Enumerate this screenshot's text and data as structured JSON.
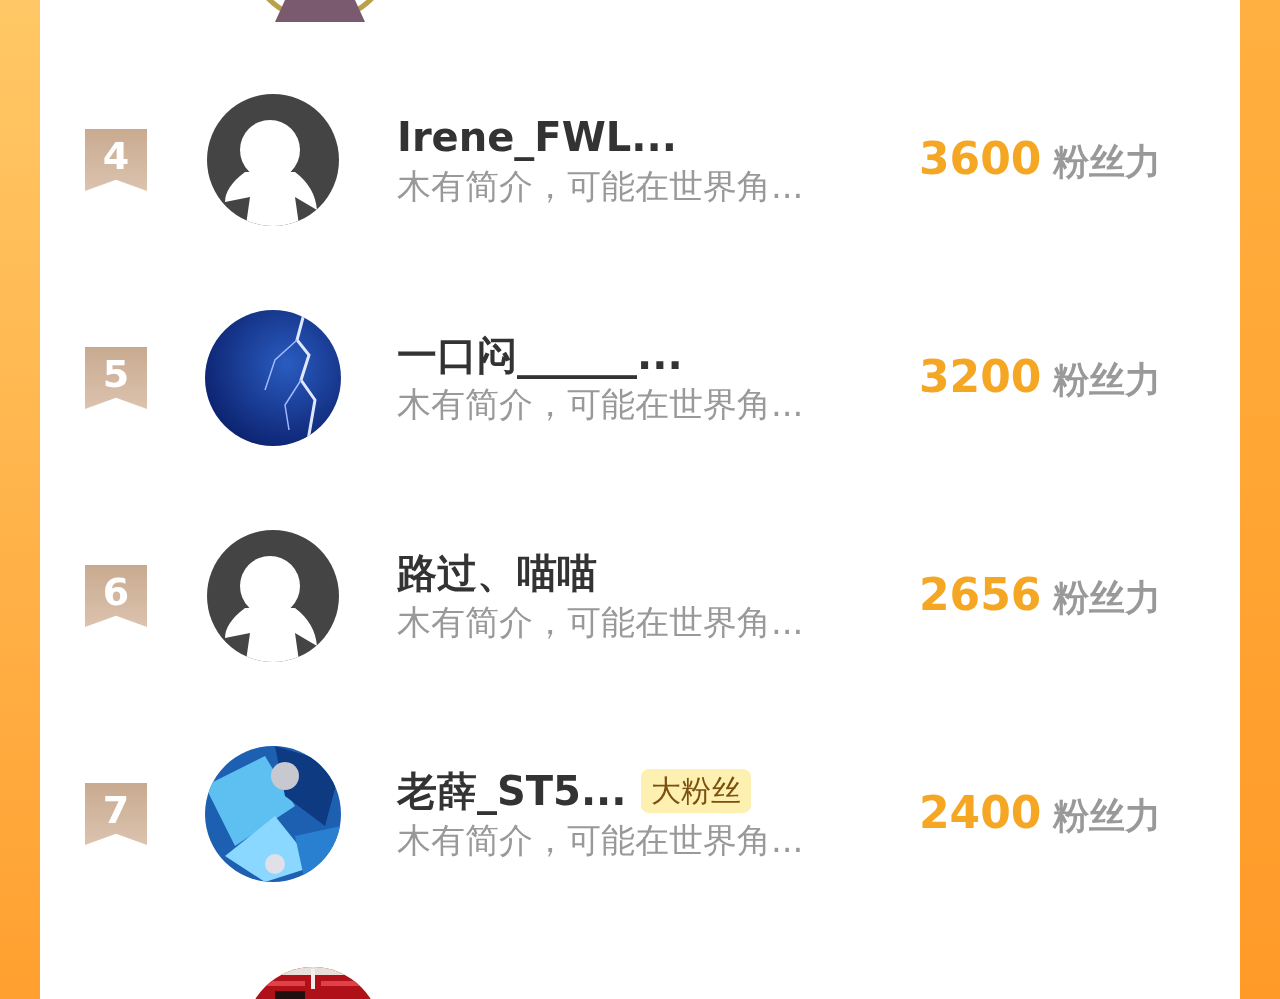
{
  "fans": [
    {
      "rank": "4",
      "avatar": {
        "kind": "default"
      },
      "name": "Irene_FWL...",
      "intro": "木有简介，可能在世界角...",
      "score": "3600",
      "unit": "粉丝力"
    },
    {
      "rank": "5",
      "avatar": {
        "kind": "lightning"
      },
      "name": "一口闷______...",
      "intro": "木有简介，可能在世界角...",
      "score": "3200",
      "unit": "粉丝力"
    },
    {
      "rank": "6",
      "avatar": {
        "kind": "default"
      },
      "name": "路过、喵喵",
      "intro": "木有简介，可能在世界角...",
      "score": "2656",
      "unit": "粉丝力"
    },
    {
      "rank": "7",
      "avatar": {
        "kind": "blue"
      },
      "name": "老薛_ST5...",
      "badge": "大粉丝",
      "intro": "木有简介，可能在世界角...",
      "score": "2400",
      "unit": "粉丝力"
    }
  ]
}
